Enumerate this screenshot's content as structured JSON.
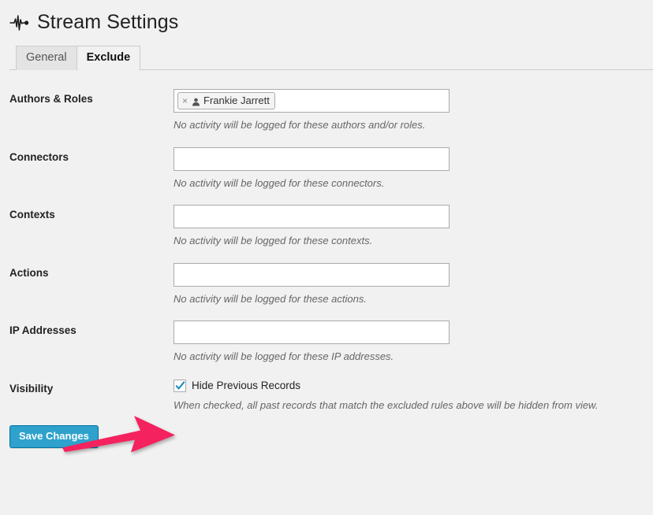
{
  "header": {
    "title": "Stream Settings",
    "logo_icon": "stream-waveform-icon"
  },
  "tabs": [
    {
      "label": "General",
      "active": false
    },
    {
      "label": "Exclude",
      "active": true
    }
  ],
  "form": {
    "rows": [
      {
        "label": "Authors & Roles",
        "type": "tokens",
        "tokens": [
          {
            "text": "Frankie Jarrett",
            "remove_glyph": "×",
            "icon": "user-icon"
          }
        ],
        "value": "",
        "placeholder": "",
        "description": "No activity will be logged for these authors and/or roles."
      },
      {
        "label": "Connectors",
        "type": "text",
        "value": "",
        "placeholder": "",
        "description": "No activity will be logged for these connectors."
      },
      {
        "label": "Contexts",
        "type": "text",
        "value": "",
        "placeholder": "",
        "description": "No activity will be logged for these contexts."
      },
      {
        "label": "Actions",
        "type": "text",
        "value": "",
        "placeholder": "",
        "description": "No activity will be logged for these actions."
      },
      {
        "label": "IP Addresses",
        "type": "text",
        "value": "",
        "placeholder": "",
        "description": "No activity will be logged for these IP addresses."
      }
    ],
    "visibility": {
      "label": "Visibility",
      "checkbox_label": "Hide Previous Records",
      "checked": true,
      "description": "When checked, all past records that match the excluded rules above will be hidden from view."
    }
  },
  "submit": {
    "save_label": "Save Changes"
  },
  "annotation": {
    "arrow_color": "#f4245e",
    "arrow_direction": "right"
  },
  "colors": {
    "page_background": "#f1f1f1",
    "primary_button": "#2ea2cc",
    "primary_button_border": "#0074a2",
    "checkbox_check": "#1e8cbe",
    "description_text": "#666666",
    "annotation_pink": "#f4245e"
  }
}
